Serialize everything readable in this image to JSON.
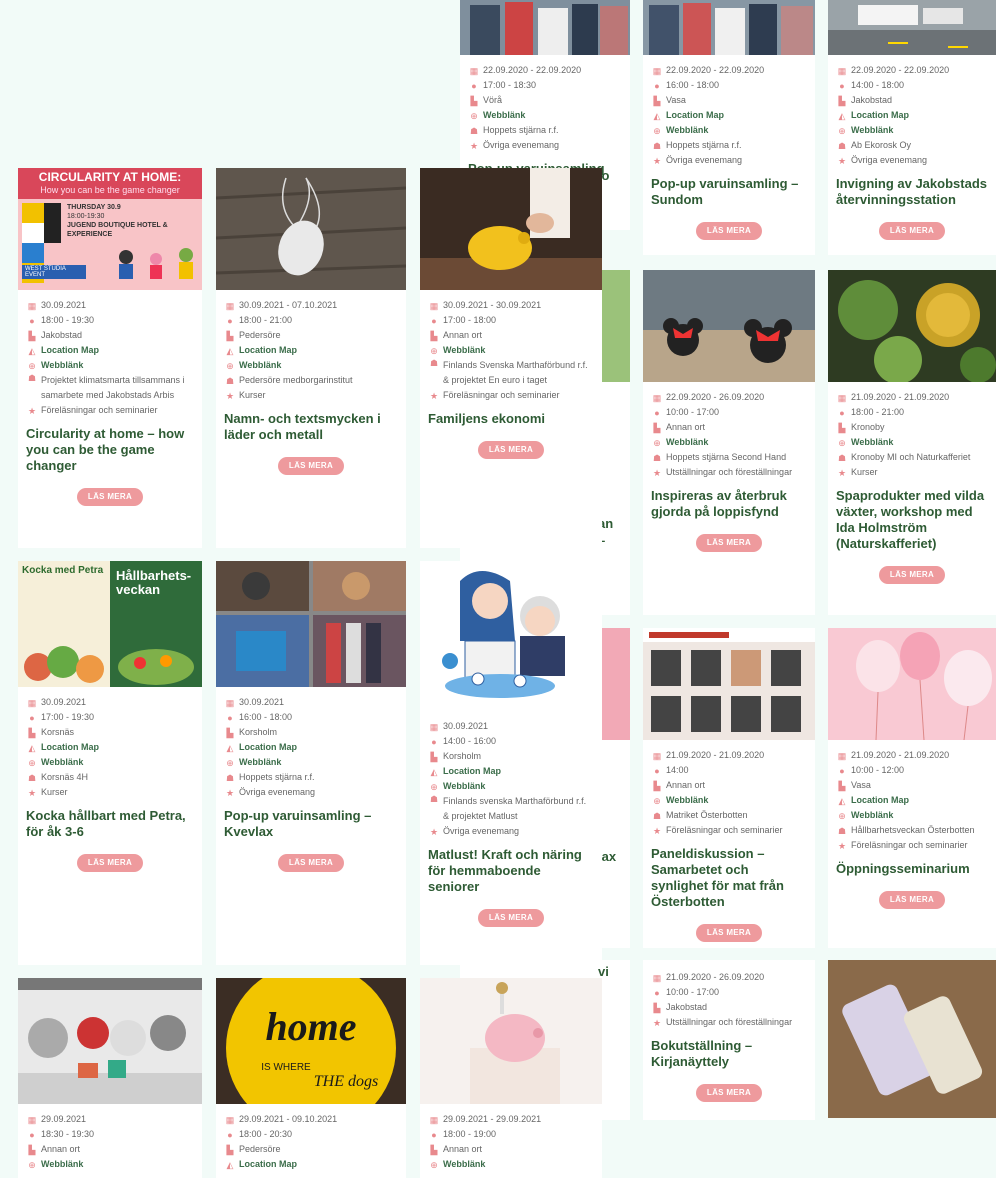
{
  "buttons": {
    "read_more": "LÄS MERA"
  },
  "colors": {
    "accent": "#ee9a9d",
    "title_green": "#2e5b34",
    "link_green": "#3b6d4a",
    "icon_pink": "#e8898d",
    "page_bg": "#f2fbf8"
  },
  "back_grid": {
    "cards": [
      {
        "dates": "22.09.2020 - 22.09.2020",
        "time": "17:00 - 18:30",
        "place": "Vörå",
        "web": "Webblänk",
        "org": "Hoppets stjärna r.f.",
        "cat": "Övriga evenemang",
        "title": "Pop-up varuinsamling"
      },
      {
        "dates": "22.09.2020 - 22.09.2020",
        "time": "16:00 - 18:00",
        "place": "Vasa",
        "map": "Location Map",
        "web": "Webblänk",
        "org": "Hoppets stjärna r.f.",
        "cat": "Övriga evenemang",
        "title": "Pop-up varuinsamling – Sundom"
      },
      {
        "dates": "22.09.2020 - 22.09.2020",
        "time": "14:00 - 18:00",
        "place": "Jakobstad",
        "map": "Location Map",
        "web": "Webblänk",
        "org": "Ab Ekorosk Oy",
        "cat": "Övriga evenemang",
        "title": "Invigning av Jakobstads återvinningsstation"
      },
      {
        "dates": "22.09.2020 - 26.09.2020",
        "time": "10:00 - 17:00",
        "place": "Annan ort",
        "web": "Webblänk",
        "org": "Hoppets stjärna Second Hand",
        "cat": "Utställningar och föreställningar",
        "title": "Inspireras av återbruk gjorda på loppisfynd"
      },
      {
        "dates": "21.09.2020 - 21.09.2020",
        "time": "18:00 - 21:00",
        "place": "Kronoby",
        "web": "Webblänk",
        "org": "Kronoby MI och Naturkafferiet",
        "cat": "Kurser",
        "title": "Spaprodukter med vilda växter, workshop med Ida Holmström (Naturskafferiet)"
      },
      {
        "dates": "21.09.2020 - 21.09.2020",
        "time": "14:00",
        "place": "Annan ort",
        "web": "Webblänk",
        "org": "Matriket Österbotten",
        "cat": "Föreläsningar och seminarier",
        "title": "Paneldiskussion – Samarbetet och synlighet för mat från Österbotten"
      },
      {
        "dates": "21.09.2020 - 21.09.2020",
        "time": "10:00 - 12:00",
        "place": "Vasa",
        "map": "Location Map",
        "web": "Webblänk",
        "org": "Hållbarhetsveckan Österbotten",
        "cat": "Föreläsningar och seminarier",
        "title": "Öppningsseminarium"
      },
      {
        "dates": "21.09.2020 - 26.09.2020",
        "time": "10:00 - 17:00",
        "place": "Jakobstad",
        "cat": "Utställningar och föreställningar",
        "title": "Bokutställning – Kirjanäyttely"
      }
    ],
    "partial": {
      "a": "mo",
      "b": "an",
      "c": "–",
      "d": "lax",
      "e": "vi"
    }
  },
  "front_grid": {
    "cards": [
      {
        "dates": "30.09.2021",
        "time": "18:00 - 19:30",
        "place": "Jakobstad",
        "map": "Location Map",
        "web": "Webblänk",
        "org": "Projektet klimatsmarta tillsammans i samarbete med Jakobstads Arbis",
        "cat": "Föreläsningar och seminarier",
        "title": "Circularity at home – how you can be the game changer",
        "poster": {
          "head": "CIRCULARITY AT HOME:",
          "sub": "How you can be the game changer",
          "when": "THURSDAY 30.9",
          "hours": "18:00-19:30",
          "where": "JUGEND BOUTIQUE HOTEL & EXPERIENCE",
          "tag": "WEST STUDIA EVENT"
        }
      },
      {
        "dates": "30.09.2021 - 07.10.2021",
        "time": "18:00 - 21:00",
        "place": "Pedersöre",
        "map": "Location Map",
        "web": "Webblänk",
        "org": "Pedersöre medborgarinstitut",
        "cat": "Kurser",
        "title": "Namn- och textsmycken i läder och metall"
      },
      {
        "dates": "30.09.2021 - 30.09.2021",
        "time": "17:00 - 18:00",
        "place": "Annan ort",
        "web": "Webblänk",
        "org": "Finlands Svenska Marthaförbund r.f. & projektet En euro i taget",
        "cat": "Föreläsningar och seminarier",
        "title": "Familjens ekonomi"
      },
      {
        "dates": "30.09.2021",
        "time": "17:00 - 19:30",
        "place": "Korsnäs",
        "map": "Location Map",
        "web": "Webblänk",
        "org": "Korsnäs 4H",
        "cat": "Kurser",
        "title": "Kocka hållbart med Petra, för åk 3-6",
        "poster": {
          "head": "Kocka med Petra",
          "side": "Hållbarhets-veckan"
        }
      },
      {
        "dates": "30.09.2021",
        "time": "16:00 - 18:00",
        "place": "Korsholm",
        "map": "Location Map",
        "web": "Webblänk",
        "org": "Hoppets stjärna r.f.",
        "cat": "Övriga evenemang",
        "title": "Pop-up varuinsamling – Kvevlax"
      },
      {
        "dates": "30.09.2021",
        "time": "14:00 - 16:00",
        "place": "Korsholm",
        "map": "Location Map",
        "web": "Webblänk",
        "org": "Finlands svenska Marthaförbund r.f. & projektet Matlust",
        "cat": "Övriga evenemang",
        "title": "Matlust! Kraft och näring för hemmaboende seniorer"
      },
      {
        "dates": "29.09.2021",
        "time": "18:30 - 19:30",
        "place": "Annan ort",
        "web": "Webblänk"
      },
      {
        "dates": "29.09.2021 - 09.10.2021",
        "time": "18:00 - 20:30",
        "place": "Pedersöre",
        "map": "Location Map",
        "sign": {
          "big": "home",
          "small1": "IS WHERE",
          "small2": "THE dogs"
        }
      },
      {
        "dates": "29.09.2021 - 29.09.2021",
        "time": "18:00 - 19:00",
        "place": "Annan ort",
        "web": "Webblänk"
      }
    ]
  }
}
